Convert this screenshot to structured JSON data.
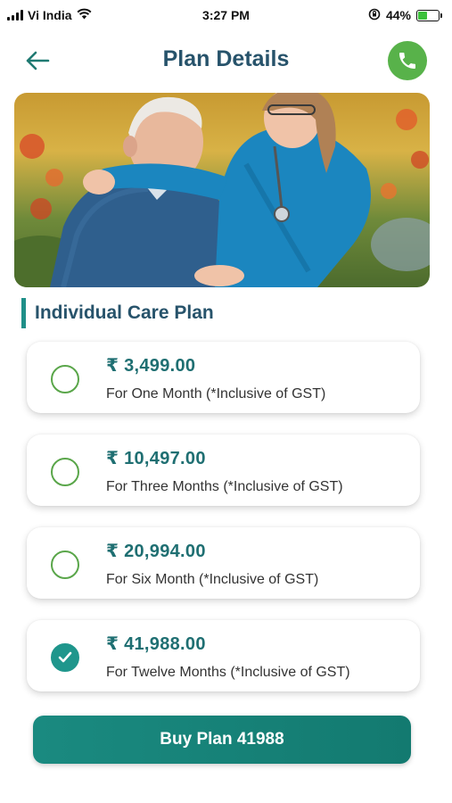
{
  "status_bar": {
    "carrier": "Vi India",
    "time": "3:27 PM",
    "battery_percent": "44%",
    "battery_level": 0.44,
    "icons": [
      "signal-icon",
      "wifi-icon",
      "orientation-lock-icon",
      "battery-charging-icon"
    ]
  },
  "header": {
    "title": "Plan Details",
    "back_icon": "arrow-left-icon",
    "call_icon": "phone-icon",
    "call_button_color": "#58b24a",
    "title_color": "#27536b"
  },
  "hero": {
    "image": "elderly-man-with-caregiver-photo"
  },
  "section": {
    "title": "Individual Care Plan",
    "accent_color": "#1f8f88"
  },
  "plans": [
    {
      "price": "₹ 3,499.00",
      "period": "For One Month (*Inclusive of GST)",
      "selected": false
    },
    {
      "price": "₹ 10,497.00",
      "period": "For Three Months (*Inclusive of GST)",
      "selected": false
    },
    {
      "price": "₹ 20,994.00",
      "period": "For Six Month (*Inclusive of GST)",
      "selected": false
    },
    {
      "price": "₹ 41,988.00",
      "period": "For Twelve Months (*Inclusive of GST)",
      "selected": true
    }
  ],
  "buy_button": {
    "label": "Buy Plan 41988",
    "color": "#1a8a80"
  }
}
